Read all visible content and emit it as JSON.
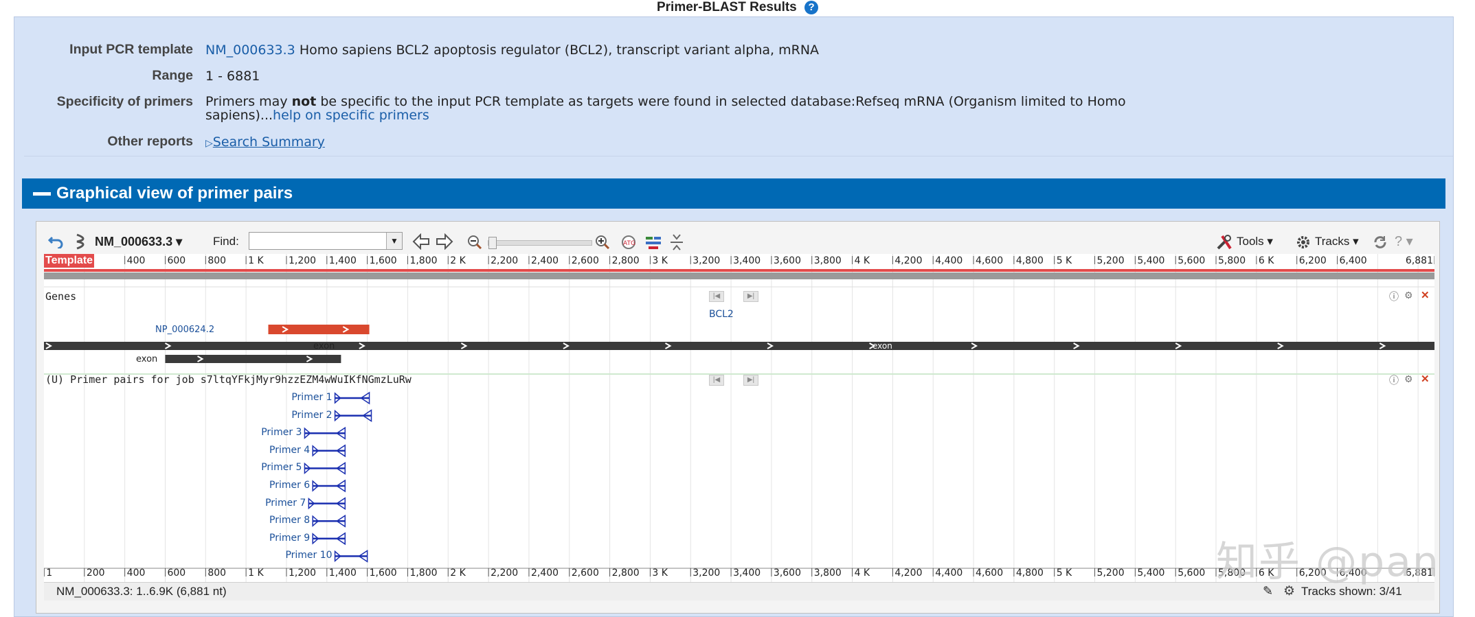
{
  "page": {
    "title": "Primer-BLAST Results",
    "help_glyph": "?"
  },
  "summary": {
    "input_label": "Input PCR template",
    "input_accession": "NM_000633.3",
    "input_desc": "Homo sapiens BCL2 apoptosis regulator (BCL2), transcript variant alpha, mRNA",
    "range_label": "Range",
    "range_value": "1 - 6881",
    "specificity_label": "Specificity of primers",
    "specificity_text_1": "Primers may ",
    "specificity_bold": "not",
    "specificity_text_2": " be specific to the input PCR template as targets were found in selected database:Refseq mRNA (Organism limited to Homo",
    "specificity_text_3": "sapiens)...",
    "specificity_link": "help on specific primers",
    "other_label": "Other reports",
    "other_link": "Search Summary"
  },
  "section": {
    "title": "Graphical view of primer pairs"
  },
  "toolbar": {
    "sequence": "NM_000633.3",
    "find_label": "Find:",
    "find_value": "",
    "tools_label": "Tools",
    "tracks_label": "Tracks"
  },
  "ruler": {
    "template_label": "Template",
    "top_ticks": [
      "400",
      "600",
      "800",
      "1 K",
      "1,200",
      "1,400",
      "1,600",
      "1,800",
      "2 K",
      "2,200",
      "2,400",
      "2,600",
      "2,800",
      "3 K",
      "3,200",
      "3,400",
      "3,600",
      "3,800",
      "4 K",
      "4,200",
      "4,400",
      "4,600",
      "4,800",
      "5 K",
      "5,200",
      "5,400",
      "5,600",
      "5,800",
      "6 K",
      "6,200",
      "6,400",
      "6,881"
    ],
    "bottom_ticks": [
      "1",
      "200",
      "400",
      "600",
      "800",
      "1 K",
      "1,200",
      "1,400",
      "1,600",
      "1,800",
      "2 K",
      "2,200",
      "2,400",
      "2,600",
      "2,800",
      "3 K",
      "3,200",
      "3,400",
      "3,600",
      "3,800",
      "4 K",
      "4,200",
      "4,400",
      "4,600",
      "4,800",
      "5 K",
      "5,200",
      "5,400",
      "5,600",
      "5,800",
      "6 K",
      "6,200",
      "6,400",
      "6,881"
    ]
  },
  "genes_track": {
    "title": "Genes",
    "gene_label": "BCL2",
    "protein_label": "NP_000624.2",
    "exon_label_1": "exon",
    "exon_label_2": "exon",
    "exon_label_3": "exon"
  },
  "primer_track": {
    "title": "(U) Primer pairs for job s7ltqYFkjMyr9hzzEZM4wWuIKfNGmzLuRw",
    "primers": [
      {
        "label": "Primer 1",
        "start": 1440,
        "end": 1610
      },
      {
        "label": "Primer 2",
        "start": 1440,
        "end": 1620
      },
      {
        "label": "Primer 3",
        "start": 1290,
        "end": 1490
      },
      {
        "label": "Primer 4",
        "start": 1330,
        "end": 1490
      },
      {
        "label": "Primer 5",
        "start": 1290,
        "end": 1490
      },
      {
        "label": "Primer 6",
        "start": 1330,
        "end": 1490
      },
      {
        "label": "Primer 7",
        "start": 1310,
        "end": 1490
      },
      {
        "label": "Primer 8",
        "start": 1330,
        "end": 1490
      },
      {
        "label": "Primer 9",
        "start": 1330,
        "end": 1490
      },
      {
        "label": "Primer 10",
        "start": 1440,
        "end": 1600
      }
    ]
  },
  "footer": {
    "status": "NM_000633.3: 1..6.9K (6,881 nt)",
    "tracks_shown": "Tracks shown: 3/41"
  },
  "watermark": "知乎 @pan",
  "colors": {
    "panel_bg": "#d6e3f7",
    "section_bar": "#0069b4",
    "template_red": "#e34b4b",
    "protein_red": "#d9482e",
    "primer_blue": "#1a2fb0",
    "link": "#1a5ea8"
  }
}
